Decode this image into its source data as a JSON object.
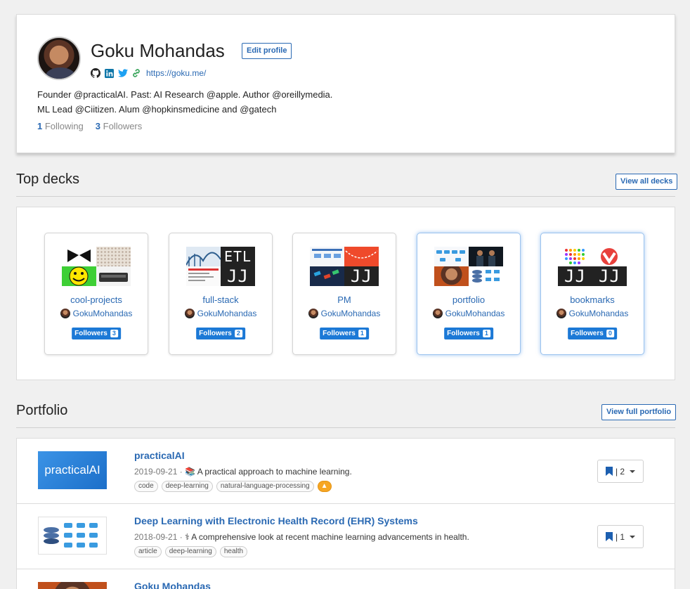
{
  "profile": {
    "name": "Goku Mohandas",
    "edit_label": "Edit profile",
    "website": "https://goku.me/",
    "bio_line1": "Founder @practicalAI. Past: AI Research @apple. Author @oreillymedia.",
    "bio_line2": "ML Lead @Ciitizen. Alum @hopkinsmedicine and @gatech",
    "following_count": "1",
    "following_label": "Following",
    "followers_count": "3",
    "followers_label": "Followers",
    "social_icons": [
      "github-icon",
      "linkedin-icon",
      "twitter-icon",
      "link-icon"
    ]
  },
  "top_decks": {
    "title": "Top decks",
    "view_all_label": "View all decks",
    "followers_label": "Followers",
    "decks": [
      {
        "title": "cool-projects",
        "owner": "GokuMohandas",
        "followers": "3"
      },
      {
        "title": "full-stack",
        "owner": "GokuMohandas",
        "followers": "2"
      },
      {
        "title": "PM",
        "owner": "GokuMohandas",
        "followers": "1"
      },
      {
        "title": "portfolio",
        "owner": "GokuMohandas",
        "followers": "1"
      },
      {
        "title": "bookmarks",
        "owner": "GokuMohandas",
        "followers": "0"
      }
    ]
  },
  "portfolio": {
    "title": "Portfolio",
    "view_full_label": "View full portfolio",
    "items": [
      {
        "title": "practicalAI",
        "thumb_text": "practicalAI",
        "date": "2019-09-21 ·",
        "emoji": "📚",
        "description": "A practical approach to machine learning.",
        "tags": [
          "code",
          "deep-learning",
          "natural-language-processing"
        ],
        "bookmarks": "| 2"
      },
      {
        "title": "Deep Learning with Electronic Health Record (EHR) Systems",
        "date": "2018-09-21 ·",
        "emoji": "⚕",
        "description": "A comprehensive look at recent machine learning advancements in health.",
        "tags": [
          "article",
          "deep-learning",
          "health"
        ],
        "bookmarks": "| 1"
      },
      {
        "title": "Goku Mohandas"
      }
    ]
  },
  "colors": {
    "link": "#2a69b3",
    "badge": "#1c79d6",
    "tag_orange": "#f6a623"
  }
}
